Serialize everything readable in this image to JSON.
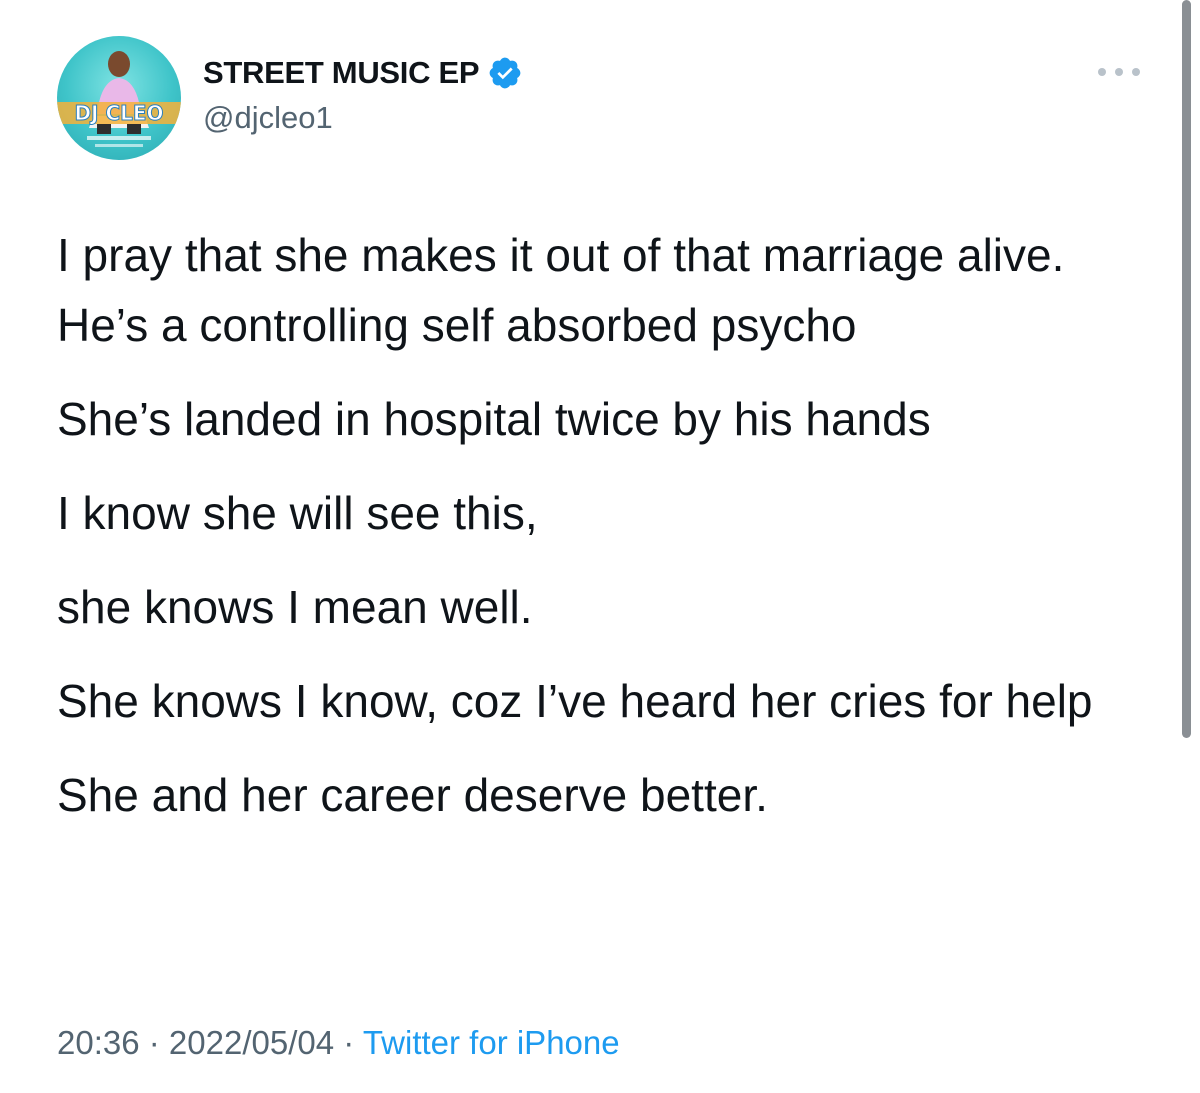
{
  "author": {
    "display_name": "STREET MUSIC EP",
    "handle": "@djcleo1",
    "avatar_icon": "profile-photo-dj-cleo",
    "avatar_logo_text": "DJ CLEO",
    "verified": true,
    "verified_color": "#1d9bf0"
  },
  "tweet": {
    "lines": [
      "I pray that she makes it out of that marriage alive.",
      "He’s a controlling self absorbed psycho",
      "She’s landed in hospital twice by his hands",
      "I know she will see this,",
      "she knows I mean well.",
      "She knows I know, coz I’ve heard her cries for help",
      "She and her career deserve better."
    ],
    "time": "20:36",
    "date": "2022/05/04",
    "separator": " · ",
    "source": "Twitter for iPhone"
  },
  "colors": {
    "text": "#0f1419",
    "secondary": "#536471",
    "link": "#1d9bf0"
  }
}
